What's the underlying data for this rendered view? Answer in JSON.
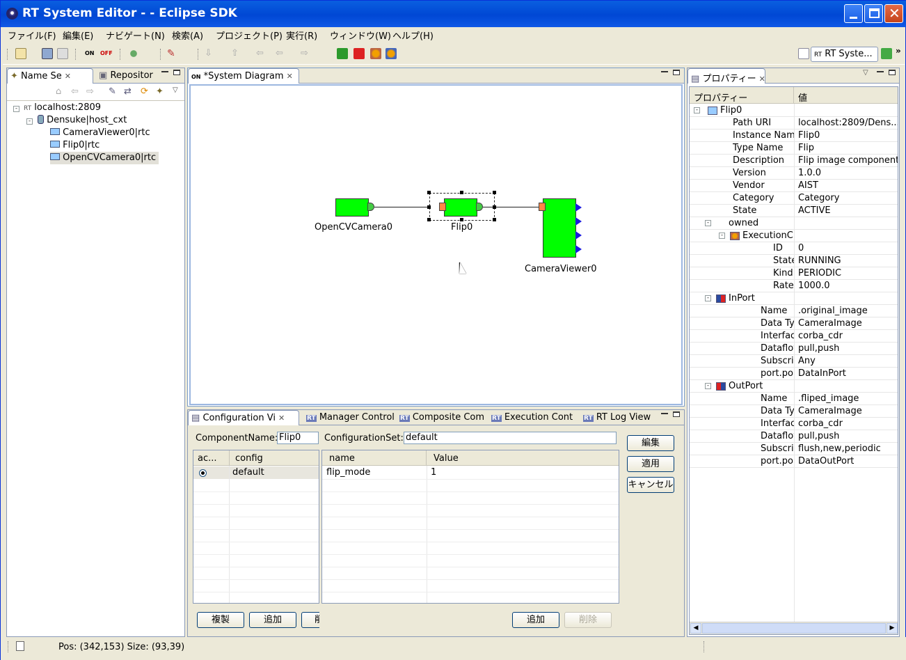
{
  "window": {
    "title": "RT System Editor -  - Eclipse SDK"
  },
  "menu": [
    "ファイル(F)",
    "編集(E)",
    "ナビゲート(N)",
    "検索(A)",
    "プロジェクト(P)",
    "実行(R)",
    "ウィンドウ(W)",
    "ヘルプ(H)"
  ],
  "toolbar": {
    "perspective_label": "RT Syste..."
  },
  "left_panel": {
    "tabs": [
      "Name Se",
      "Repositor"
    ],
    "tree": [
      {
        "label": "localhost:2809",
        "prefix": "RT"
      },
      {
        "label": "Densuke|host_cxt"
      },
      {
        "label": "CameraViewer0|rtc"
      },
      {
        "label": "Flip0|rtc"
      },
      {
        "label": "OpenCVCamera0|rtc"
      }
    ]
  },
  "editor": {
    "tab": "*System Diagram",
    "components": {
      "camera": "OpenCVCamera0",
      "flip": "Flip0",
      "viewer": "CameraViewer0"
    }
  },
  "bottom": {
    "tabs": [
      "Configuration Vi",
      "Manager Control",
      "Composite Com",
      "Execution Cont",
      "RT Log View"
    ],
    "component_name_label": "ComponentName:",
    "component_name": "Flip0",
    "config_set_label": "ConfigurationSet:",
    "config_set": "default",
    "left_grid": {
      "headers": [
        "ac...",
        "config"
      ],
      "rows": [
        {
          "config": "default"
        }
      ]
    },
    "right_grid": {
      "headers": [
        "name",
        "Value"
      ],
      "rows": [
        {
          "name": "flip_mode",
          "value": "1"
        }
      ]
    },
    "buttons": {
      "edit": "編集",
      "apply": "適用",
      "cancel": "キャンセル",
      "copy": "複製",
      "add_left": "追加",
      "delete_left": "削",
      "add_right": "追加",
      "delete_right": "削除"
    }
  },
  "properties": {
    "tab": "プロパティー",
    "col_prop": "プロパティー",
    "col_value": "値",
    "rows": [
      {
        "k": "Flip0",
        "v": ""
      },
      {
        "k": "Path URI",
        "v": "localhost:2809/Dens..."
      },
      {
        "k": "Instance Nam",
        "v": "Flip0"
      },
      {
        "k": "Type Name",
        "v": "Flip"
      },
      {
        "k": "Description",
        "v": "Flip image component"
      },
      {
        "k": "Version",
        "v": "1.0.0"
      },
      {
        "k": "Vendor",
        "v": "AIST"
      },
      {
        "k": "Category",
        "v": "Category"
      },
      {
        "k": "State",
        "v": "ACTIVE"
      },
      {
        "k": "owned",
        "v": ""
      },
      {
        "k": "ExecutionC",
        "v": ""
      },
      {
        "k": "ID",
        "v": "0"
      },
      {
        "k": "State",
        "v": "RUNNING"
      },
      {
        "k": "Kind",
        "v": "PERIODIC"
      },
      {
        "k": "Rate",
        "v": "1000.0"
      },
      {
        "k": "InPort",
        "v": ""
      },
      {
        "k": "Name",
        "v": ".original_image"
      },
      {
        "k": "Data Type",
        "v": "CameraImage"
      },
      {
        "k": "Interface T",
        "v": "corba_cdr"
      },
      {
        "k": "Dataflow T",
        "v": "pull,push"
      },
      {
        "k": "Subscriptio",
        "v": "Any"
      },
      {
        "k": "port.port_ty",
        "v": "DataInPort"
      },
      {
        "k": "OutPort",
        "v": ""
      },
      {
        "k": "Name",
        "v": ".fliped_image"
      },
      {
        "k": "Data Type",
        "v": "CameraImage"
      },
      {
        "k": "Interface T",
        "v": "corba_cdr"
      },
      {
        "k": "Dataflow T",
        "v": "pull,push"
      },
      {
        "k": "Subscriptio",
        "v": "flush,new,periodic"
      },
      {
        "k": "port.port_ty",
        "v": "DataOutPort"
      }
    ]
  },
  "status": {
    "text": "Pos: (342,153) Size: (93,39)"
  },
  "colors": {
    "component": "#00ff00",
    "title": "#0a5fe0"
  }
}
